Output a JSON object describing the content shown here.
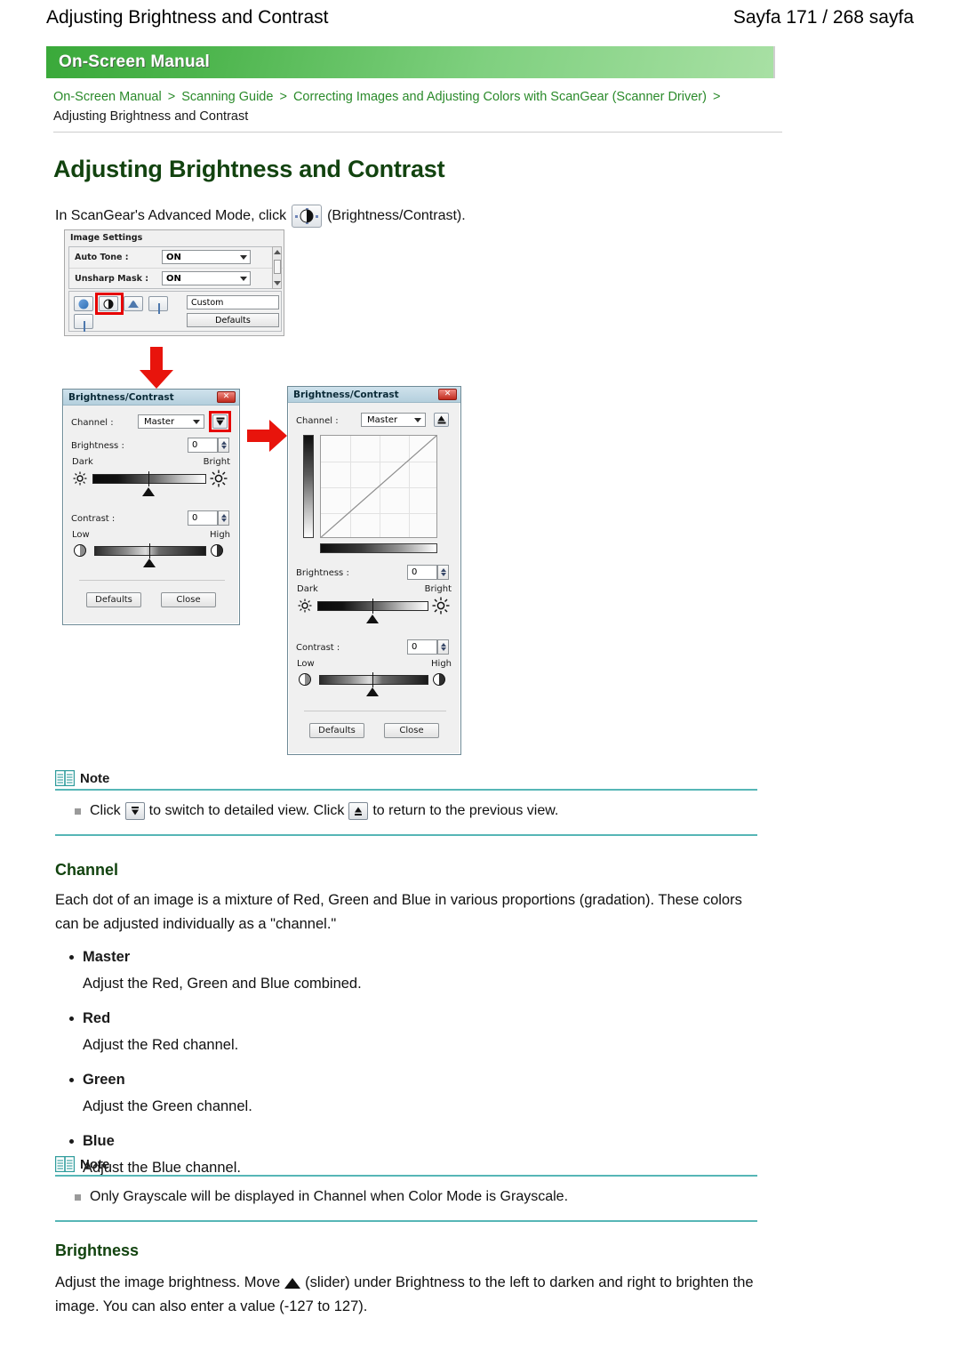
{
  "page_header": {
    "title": "Adjusting Brightness and Contrast",
    "page_count": "Sayfa 171 / 268 sayfa"
  },
  "banner": {
    "label": "On-Screen Manual"
  },
  "breadcrumb": {
    "items": [
      {
        "label": "On-Screen Manual",
        "link": true
      },
      {
        "label": "Scanning Guide",
        "link": true
      },
      {
        "label": "Correcting Images and Adjusting Colors with ScanGear (Scanner Driver)",
        "link": true
      }
    ],
    "separator": ">",
    "trailing_separator": ">",
    "current": "Adjusting Brightness and Contrast"
  },
  "doc": {
    "title": "Adjusting Brightness and Contrast",
    "intro_before": "In ScanGear's Advanced Mode, click",
    "intro_icon": "brightness-contrast-button-icon",
    "intro_after": "(Brightness/Contrast)."
  },
  "image_settings": {
    "title": "Image Settings",
    "rows": [
      {
        "label": "Auto Tone :",
        "value": "ON"
      },
      {
        "label": "Unsharp Mask :",
        "value": "ON"
      }
    ],
    "tools": [
      {
        "name": "fading-correction-icon"
      },
      {
        "name": "brightness-contrast-icon",
        "highlighted": true
      },
      {
        "name": "histogram-icon"
      },
      {
        "name": "tone-curve-icon"
      },
      {
        "name": "final-review-icon"
      }
    ],
    "preset_value": "Custom",
    "defaults_label": "Defaults"
  },
  "dialog_simple": {
    "title": "Brightness/Contrast",
    "close_glyph": "✕",
    "channel_label": "Channel :",
    "channel_value": "Master",
    "expand_button": "detailed-view-button",
    "brightness_label": "Brightness :",
    "brightness_value": "0",
    "brightness_min_label": "Dark",
    "brightness_max_label": "Bright",
    "contrast_label": "Contrast :",
    "contrast_value": "0",
    "contrast_min_label": "Low",
    "contrast_max_label": "High",
    "defaults_label": "Defaults",
    "close_label": "Close"
  },
  "dialog_detailed": {
    "title": "Brightness/Contrast",
    "close_glyph": "✕",
    "channel_label": "Channel :",
    "channel_value": "Master",
    "collapse_button": "previous-view-button",
    "brightness_label": "Brightness :",
    "brightness_value": "0",
    "brightness_min_label": "Dark",
    "brightness_max_label": "Bright",
    "contrast_label": "Contrast :",
    "contrast_value": "0",
    "contrast_min_label": "Low",
    "contrast_max_label": "High",
    "defaults_label": "Defaults",
    "close_label": "Close"
  },
  "note1": {
    "label": "Note",
    "text_a": "Click",
    "icon_a": "down-arrow-bar-icon",
    "text_b": "to switch to detailed view. Click",
    "icon_b": "up-arrow-bar-icon",
    "text_c": "to return to the previous view."
  },
  "channel_section": {
    "heading": "Channel",
    "paragraph": "Each dot of an image is a mixture of Red, Green and Blue in various proportions (gradation). These colors can be adjusted individually as a \"channel.\"",
    "items": [
      {
        "label": "Master",
        "desc": "Adjust the Red, Green and Blue combined."
      },
      {
        "label": "Red",
        "desc": "Adjust the Red channel."
      },
      {
        "label": "Green",
        "desc": "Adjust the Green channel."
      },
      {
        "label": "Blue",
        "desc": "Adjust the Blue channel."
      }
    ]
  },
  "note2": {
    "label": "Note",
    "text": "Only Grayscale will be displayed in Channel when Color Mode is Grayscale."
  },
  "brightness_section": {
    "heading": "Brightness",
    "text_a": "Adjust the image brightness. Move",
    "icon": "slider-triangle-icon",
    "text_b": "(slider) under Brightness to the left to darken and right to brighten the image. You can also enter a value (-127 to 127)."
  },
  "colors": {
    "heading_green": "#12430f",
    "link_green": "#2a8a2a",
    "note_teal": "#56b6b6",
    "arrow_red": "#e60000",
    "banner_green": "#4db54d"
  }
}
